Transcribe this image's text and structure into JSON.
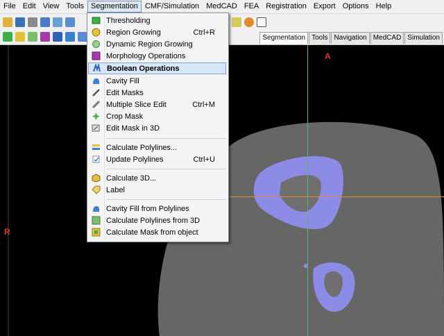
{
  "menubar": {
    "items": [
      "File",
      "Edit",
      "View",
      "Tools",
      "Segmentation",
      "CMF/Simulation",
      "MedCAD",
      "FEA",
      "Registration",
      "Export",
      "Options",
      "Help"
    ],
    "active": "Segmentation"
  },
  "tabs": [
    "Segmentation",
    "Tools",
    "Navigation",
    "MedCAD",
    "Simulation"
  ],
  "active_tab": "Segmentation",
  "viewer": {
    "top_marker": "A",
    "left_marker": "R"
  },
  "menu": {
    "items": [
      {
        "label": "Thresholding",
        "shortcut": "",
        "icon": "threshold-icon"
      },
      {
        "label": "Region Growing",
        "shortcut": "Ctrl+R",
        "icon": "region-growing-icon"
      },
      {
        "label": "Dynamic Region Growing",
        "shortcut": "",
        "icon": "dynamic-region-growing-icon"
      },
      {
        "label": "Morphology Operations",
        "shortcut": "",
        "icon": "morphology-icon"
      },
      {
        "label": "Boolean Operations",
        "shortcut": "",
        "icon": "boolean-icon"
      },
      {
        "label": "Cavity Fill",
        "shortcut": "",
        "icon": "cavity-fill-icon"
      },
      {
        "label": "Edit Masks",
        "shortcut": "",
        "icon": "edit-masks-icon"
      },
      {
        "label": "Multiple Slice Edit",
        "shortcut": "Ctrl+M",
        "icon": "multiple-slice-edit-icon"
      },
      {
        "label": "Crop Mask",
        "shortcut": "",
        "icon": "crop-mask-icon"
      },
      {
        "label": "Edit Mask in 3D",
        "shortcut": "",
        "icon": "edit-mask-3d-icon"
      },
      {
        "label": "Calculate Polylines...",
        "shortcut": "",
        "icon": "calculate-polylines-icon"
      },
      {
        "label": "Update Polylines",
        "shortcut": "Ctrl+U",
        "icon": "update-polylines-icon"
      },
      {
        "label": "Calculate 3D...",
        "shortcut": "",
        "icon": "calculate-3d-icon"
      },
      {
        "label": "Label",
        "shortcut": "",
        "icon": "label-icon"
      },
      {
        "label": "Cavity Fill from Polylines",
        "shortcut": "",
        "icon": "cavity-fill-polylines-icon"
      },
      {
        "label": "Calculate Polylines from 3D",
        "shortcut": "",
        "icon": "polylines-from-3d-icon"
      },
      {
        "label": "Calculate Mask from object",
        "shortcut": "",
        "icon": "mask-from-object-icon"
      }
    ],
    "highlighted": "Boolean Operations"
  },
  "colors": {
    "accent": "#7fa4d4",
    "marker": "#e0342a",
    "crosshair_h": "#e0902a",
    "crosshair_v": "#4fb86a",
    "mask": "#8c8ce6"
  }
}
